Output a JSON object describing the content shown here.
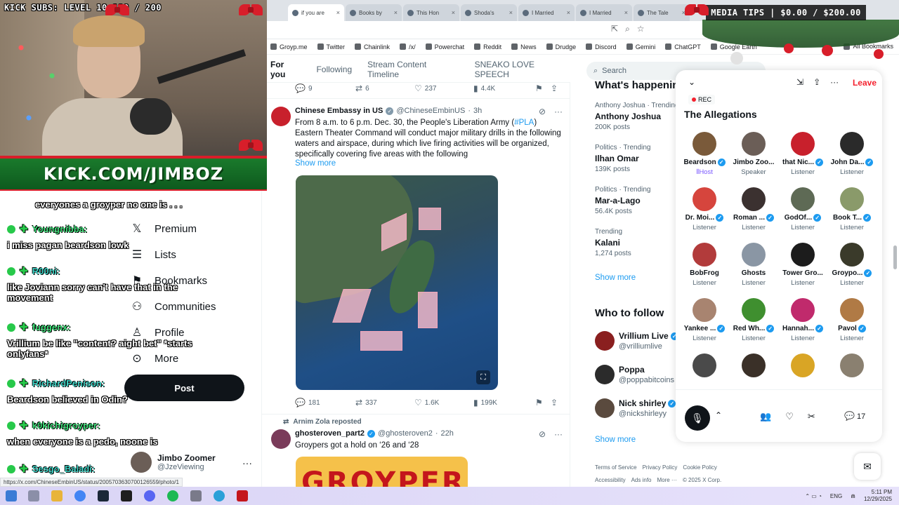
{
  "browser": {
    "tabs": [
      {
        "label": "if you are",
        "active": true
      },
      {
        "label": "Books by",
        "active": false
      },
      {
        "label": "This Hon",
        "active": false
      },
      {
        "label": "Shoda's",
        "active": false
      },
      {
        "label": "I Married",
        "active": false
      },
      {
        "label": "I Married",
        "active": false
      },
      {
        "label": "The Tale",
        "active": false
      }
    ],
    "bookmarks": [
      "Groyp.me",
      "Twitter",
      "Chainlink",
      "/x/",
      "Powerchat",
      "Reddit",
      "News",
      "Drudge",
      "Discord",
      "Gemini",
      "ChatGPT",
      "Google Earth"
    ],
    "all_bookmarks": "All Bookmarks",
    "status_url": "https://x.com/ChineseEmbinUS/status/2005703630700126559/photo/1"
  },
  "overlay": {
    "kick_subs": "KICK SUBS: LEVEL 10 190 / 200",
    "banner": "KICK.COM/JIMBOZ",
    "media_tips": "MEDIA TIPS | $0.00 / $200.00",
    "chat": [
      {
        "text": "everyones a groyper no one is . . ."
      },
      {
        "name": "Youngnibba:",
        "message": "i miss pagan beardson lowk"
      },
      {
        "name": "R00ni:",
        "message": "like Joviann sorry can't have that in the movement"
      },
      {
        "name": "fuggenx:",
        "message": "Vrillium be like \"content? aight bet\" *starts onlyfans*"
      },
      {
        "name": "RichardPenison:",
        "message": "Beardson believed in Odin?"
      },
      {
        "name": "k0kichigroyper:",
        "message": "when everyone is a pedo, noone is"
      },
      {
        "name": "Sesgo_Baladi:",
        "message": ""
      }
    ]
  },
  "nav": {
    "items": [
      {
        "label": "Premium",
        "icon": "x-logo-icon"
      },
      {
        "label": "Lists",
        "icon": "list-icon"
      },
      {
        "label": "Bookmarks",
        "icon": "bookmark-icon"
      },
      {
        "label": "Communities",
        "icon": "communities-icon"
      },
      {
        "label": "Profile",
        "icon": "person-icon"
      },
      {
        "label": "More",
        "icon": "more-circle-icon"
      }
    ],
    "post_label": "Post",
    "account": {
      "name": "Jimbo Zoomer",
      "handle": "@JzeViewing"
    }
  },
  "timeline": {
    "tabs": [
      "For you",
      "Following",
      "Stream Content Timeline",
      "SNEAKO LOVE SPEECH"
    ],
    "prev_stats": {
      "replies": "9",
      "reposts": "6",
      "likes": "237",
      "views": "4.4K"
    },
    "tweet1": {
      "name": "Chinese Embassy in US",
      "handle": "@ChineseEmbinUS",
      "time": "3h",
      "text_before": "From 8 a.m. to 6 p.m. Dec. 30, the People's Liberation Army (",
      "hashtag": "#PLA",
      "text_after": ") Eastern Theater Command will conduct major military drills in the following waters and airspace, during which live firing activities will be organized, specifically covering five areas with the following",
      "show_more": "Show more",
      "stats": {
        "replies": "181",
        "reposts": "337",
        "likes": "1.6K",
        "views": "199K"
      }
    },
    "tweet2": {
      "repost_by": "Arnim Zola reposted",
      "name": "ghosteroven_part2",
      "handle": "@ghosteroven2",
      "time": "22h",
      "text": "Groypers got a hold on ‘26 and ‘28",
      "image_text": "GROYPER"
    }
  },
  "right": {
    "search_placeholder": "Search",
    "happening_title": "What's happening",
    "trends": [
      {
        "context": "Anthony Joshua · Trending",
        "title": "Anthony Joshua",
        "posts": "200K posts"
      },
      {
        "context": "Politics · Trending",
        "title": "Ilhan Omar",
        "posts": "139K posts"
      },
      {
        "context": "Politics · Trending",
        "title": "Mar-a-Lago",
        "posts": "56.4K posts"
      },
      {
        "context": "Trending",
        "title": "Kalani",
        "posts": "1,274 posts"
      }
    ],
    "show_more": "Show more",
    "who_to_follow_title": "Who to follow",
    "follow": [
      {
        "name": "Vrillium Live",
        "handle": "@vrilliumlive",
        "verified": true
      },
      {
        "name": "Poppa",
        "handle": "@poppabitcoins",
        "verified": false
      },
      {
        "name": "Nick shirley",
        "handle": "@nickshirleyy",
        "verified": true
      }
    ],
    "show_more_2": "Show more",
    "footer1": [
      "Terms of Service",
      "Privacy Policy",
      "Cookie Policy"
    ],
    "footer2": [
      "Accessibility",
      "Ads info",
      "More ···",
      "© 2025 X Corp."
    ]
  },
  "space": {
    "leave_label": "Leave",
    "rec_label": "REC",
    "title": "The Allegations",
    "members": [
      {
        "name": "Beardson",
        "role": "Host",
        "verified": true,
        "color": "#7a5a3a"
      },
      {
        "name": "Jimbo Zoo...",
        "role": "Speaker",
        "verified": false,
        "color": "#6b5e57"
      },
      {
        "name": "that Nic...",
        "role": "Listener",
        "verified": true,
        "color": "#c8202c"
      },
      {
        "name": "John Da...",
        "role": "Listener",
        "verified": true,
        "color": "#2a2a2a"
      },
      {
        "name": "Dr. Moi...",
        "role": "Listener",
        "verified": true,
        "color": "#d6453d"
      },
      {
        "name": "Roman ...",
        "role": "Listener",
        "verified": true,
        "color": "#3b3130"
      },
      {
        "name": "GodOf...",
        "role": "Listener",
        "verified": true,
        "color": "#5e6a55"
      },
      {
        "name": "Book T...",
        "role": "Listener",
        "verified": true,
        "color": "#8a9a6a"
      },
      {
        "name": "BobFrog",
        "role": "Listener",
        "verified": false,
        "color": "#b23b3b"
      },
      {
        "name": "Ghosts",
        "role": "Listener",
        "verified": false,
        "color": "#8a96a4"
      },
      {
        "name": "Tower Gro...",
        "role": "Listener",
        "verified": false,
        "color": "#1c1c1c"
      },
      {
        "name": "Groypo...",
        "role": "Listener",
        "verified": true,
        "color": "#3a3a2a"
      },
      {
        "name": "Yankee ...",
        "role": "Listener",
        "verified": true,
        "color": "#a88470"
      },
      {
        "name": "Red Wh...",
        "role": "Listener",
        "verified": true,
        "color": "#3f8f2f"
      },
      {
        "name": "Hannah...",
        "role": "Listener",
        "verified": true,
        "color": "#c02a6c"
      },
      {
        "name": "Pavol",
        "role": "Listener",
        "verified": true,
        "color": "#b07a45"
      },
      {
        "name": "",
        "role": "",
        "verified": false,
        "color": "#4a4a4a"
      },
      {
        "name": "",
        "role": "",
        "verified": false,
        "color": "#3a3028"
      },
      {
        "name": "",
        "role": "",
        "verified": false,
        "color": "#d9a525"
      },
      {
        "name": "",
        "role": "",
        "verified": false,
        "color": "#8a8070"
      }
    ],
    "comment_count": "17"
  },
  "taskbar": {
    "lang": "ENG",
    "time": "5:11 PM",
    "date": "12/29/2025"
  }
}
